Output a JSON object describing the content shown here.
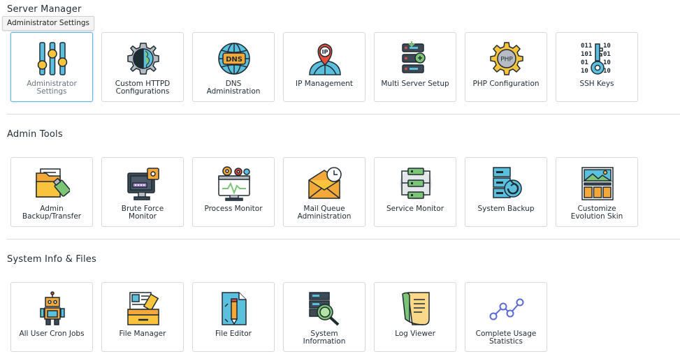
{
  "sections": [
    {
      "title": "Server Manager",
      "tiles": [
        {
          "label": "Administrator\nSettings",
          "icon": "sliders-icon"
        },
        {
          "label": "Custom HTTPD\nConfigurations",
          "icon": "gear-globe-icon"
        },
        {
          "label": "DNS\nAdministration",
          "icon": "dns-globe-icon"
        },
        {
          "label": "IP Management",
          "icon": "ip-pin-icon"
        },
        {
          "label": "Multi Server Setup",
          "icon": "server-stack-icon"
        },
        {
          "label": "PHP Configuration",
          "icon": "php-gear-icon"
        },
        {
          "label": "SSH Keys",
          "icon": "binary-key-icon"
        }
      ]
    },
    {
      "title": "Admin Tools",
      "tiles": [
        {
          "label": "Admin\nBackup/Transfer",
          "icon": "folder-usb-icon"
        },
        {
          "label": "Brute Force\nMonitor",
          "icon": "monitor-lock-icon"
        },
        {
          "label": "Process Monitor",
          "icon": "monitor-gears-icon"
        },
        {
          "label": "Mail Queue\nAdministration",
          "icon": "envelope-clock-icon"
        },
        {
          "label": "Service Monitor",
          "icon": "service-flow-icon"
        },
        {
          "label": "System Backup",
          "icon": "server-backup-icon"
        },
        {
          "label": "Customize\nEvolution Skin",
          "icon": "skin-gallery-icon"
        }
      ]
    },
    {
      "title": "System Info & Files",
      "tiles": [
        {
          "label": "All User Cron Jobs",
          "icon": "robot-icon"
        },
        {
          "label": "File Manager",
          "icon": "file-cabinet-icon"
        },
        {
          "label": "File Editor",
          "icon": "document-pencil-icon"
        },
        {
          "label": "System\nInformation",
          "icon": "server-magnifier-icon"
        },
        {
          "label": "Log Viewer",
          "icon": "log-scroll-icon"
        },
        {
          "label": "Complete Usage\nStatistics",
          "icon": "line-stats-icon"
        }
      ]
    }
  ],
  "tooltip": "Administrator Settings",
  "colors": {
    "active_border": "#64b5dc",
    "navy": "#1f2b33",
    "orange": "#f4a83a",
    "blue": "#5bc0de"
  }
}
